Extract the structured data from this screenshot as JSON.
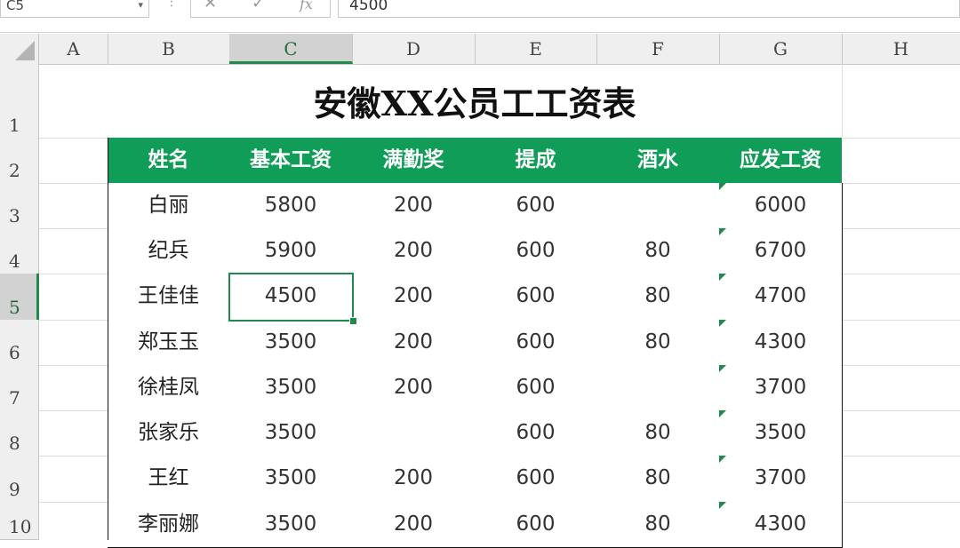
{
  "formula_bar": {
    "name_box": "C5",
    "formula": "4500"
  },
  "column_headers": [
    "A",
    "B",
    "C",
    "D",
    "E",
    "F",
    "G",
    "H"
  ],
  "selected_column": "C",
  "row_headers": [
    "1",
    "2",
    "3",
    "4",
    "5",
    "6",
    "7",
    "8",
    "9",
    "10"
  ],
  "selected_row": "5",
  "sheet": {
    "title": "安徽XX公员工工资表",
    "table_headers": [
      "姓名",
      "基本工资",
      "满勤奖",
      "提成",
      "酒水",
      "应发工资"
    ],
    "rows": [
      [
        "白丽",
        "5800",
        "200",
        "600",
        "",
        "6000"
      ],
      [
        "纪兵",
        "5900",
        "200",
        "600",
        "80",
        "6700"
      ],
      [
        "王佳佳",
        "4500",
        "200",
        "600",
        "80",
        "4700"
      ],
      [
        "郑玉玉",
        "3500",
        "200",
        "600",
        "80",
        "4300"
      ],
      [
        "徐桂凤",
        "3500",
        "200",
        "600",
        "",
        "3700"
      ],
      [
        "张家乐",
        "3500",
        "",
        "600",
        "80",
        "3500"
      ],
      [
        "王红",
        "3500",
        "200",
        "600",
        "80",
        "3700"
      ],
      [
        "李丽娜",
        "3500",
        "200",
        "600",
        "80",
        "4300"
      ]
    ]
  },
  "colors": {
    "header_fill": "#0f9d58",
    "selection": "#1f8a4c"
  },
  "icons": {
    "cancel": "close-icon",
    "confirm": "check-icon",
    "function": "fx-icon",
    "name_dropdown": "chevron-down-icon"
  }
}
